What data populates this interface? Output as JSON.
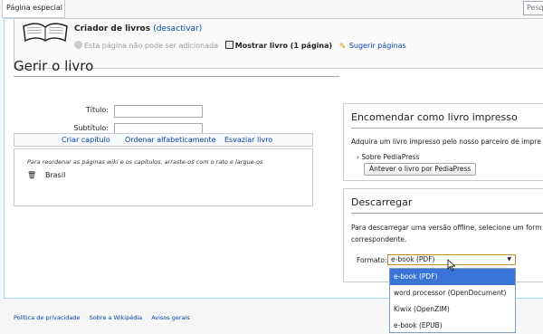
{
  "tab": {
    "label": "Página especial"
  },
  "search": {
    "placeholder": "Pesq"
  },
  "creator": {
    "title": "Criador de livros",
    "deactivate_label": "(desactivar)",
    "cannot_add": "Esta página não pode ser adicionada",
    "show_book": "Mostrar livro (1 página)",
    "suggest": "Sugerir páginas"
  },
  "page_title": "Gerir o livro",
  "form": {
    "title_label": "Título:",
    "subtitle_label": "Subtítulo:"
  },
  "collection": {
    "actions": [
      "Criar capítulo",
      "Ordenar alfabeticamente",
      "Esvaziar livro"
    ],
    "hint": "Para reordenar as páginas wiki e os capítulos, arraste-os com o rato e largue-os",
    "items": [
      {
        "title": "Brasil"
      }
    ]
  },
  "print_panel": {
    "heading": "Encomendar como livro impresso",
    "text": "Adquira um livro impresso pelo nosso parceiro de impre",
    "about_link": "Sobre PediaPress",
    "preview_button": "Antever o livro por PediaPress"
  },
  "download_panel": {
    "heading": "Descarregar",
    "text_line1": "Para descarregar uma versão offline, selecione um form",
    "text_line2": "correspondente.",
    "format_label": "Formato:",
    "selected_format": "e-book (PDF)",
    "options": [
      "e-book (PDF)",
      "word processor (OpenDocument)",
      "Kiwix (OpenZIM)",
      "e-book (EPUB)"
    ]
  },
  "footer": {
    "links": [
      "Política de privacidade",
      "Sobre a Wikipédia",
      "Avisos gerais"
    ]
  },
  "colors": {
    "link": "#0645ad",
    "selected_option": "#3875d7",
    "select_border": "#c88b2c"
  }
}
